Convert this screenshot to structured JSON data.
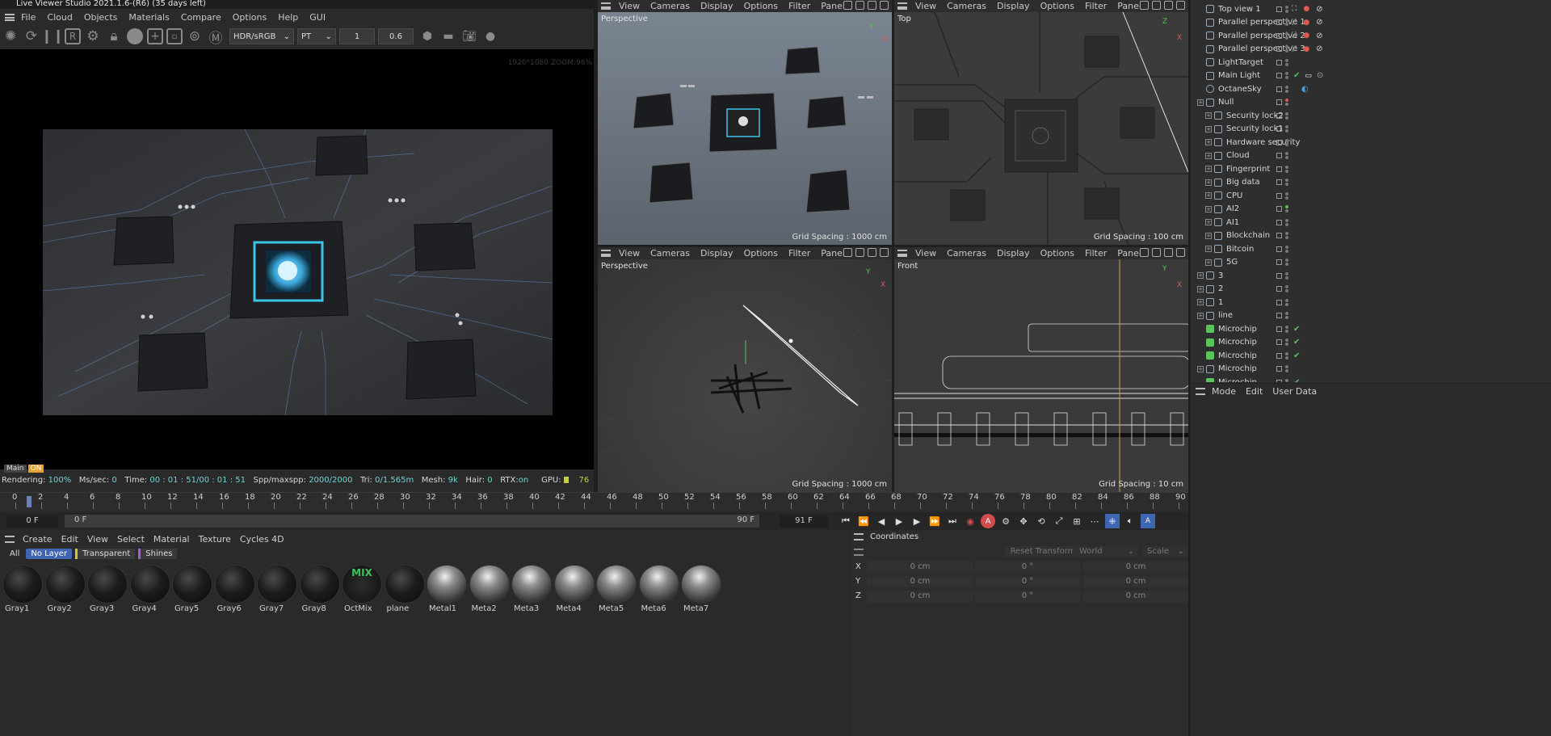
{
  "window": {
    "title": "Live Viewer Studio 2021.1.6-(R6) (35 days left)"
  },
  "lv_menu": [
    "File",
    "Cloud",
    "Objects",
    "Materials",
    "Compare",
    "Options",
    "Help",
    "GUI"
  ],
  "lv_toolbar": {
    "colorspace": "HDR/sRGB",
    "kernel": "PT",
    "value1": "1",
    "value2": "0.6"
  },
  "lv_overlay": "1920*1080 ZOOM:96%",
  "lv_tabs": {
    "main": "Main",
    "active": "ON"
  },
  "lv_status": {
    "rendering_label": "Rendering:",
    "rendering": "100%",
    "ms_label": "Ms/sec:",
    "ms": "0",
    "time_label": "Time:",
    "time": "00 : 01 : 51/00 : 01 : 51",
    "spp_label": "Spp/maxspp:",
    "spp": "2000/2000",
    "tri_label": "Tri:",
    "tri": "0/1.565m",
    "mesh_label": "Mesh:",
    "mesh": "9k",
    "hair_label": "Hair:",
    "hair": "0",
    "rtx_label": "RTX:",
    "rtx": "on",
    "gpu_label": "GPU:",
    "gpu": "76"
  },
  "viewport_menu": [
    "View",
    "Cameras",
    "Display",
    "Options",
    "Filter",
    "Panel"
  ],
  "viewports": [
    {
      "name": "Perspective",
      "grid": "Grid Spacing : 1000 cm"
    },
    {
      "name": "Top",
      "grid": "Grid Spacing : 100 cm"
    },
    {
      "name": "Perspective",
      "grid": "Grid Spacing : 1000 cm"
    },
    {
      "name": "Front",
      "grid": "Grid Spacing : 10 cm"
    }
  ],
  "axis": {
    "x": "X",
    "y": "Y"
  },
  "objects": [
    {
      "label": "Top view 1",
      "kind": "cam",
      "exp": false
    },
    {
      "label": "Parallel perspective 1",
      "kind": "cam",
      "exp": false
    },
    {
      "label": "Parallel perspective 2",
      "kind": "cam",
      "exp": false
    },
    {
      "label": "Parallel perspective 3",
      "kind": "cam",
      "exp": false
    },
    {
      "label": "LightTarget",
      "kind": "null",
      "exp": false
    },
    {
      "label": "Main Light",
      "kind": "light",
      "exp": false
    },
    {
      "label": "OctaneSky",
      "kind": "sky",
      "exp": false
    },
    {
      "label": "Null",
      "kind": "null",
      "exp": true
    },
    {
      "label": "Security lock2",
      "kind": "grp",
      "exp": true,
      "indent": 1
    },
    {
      "label": "Security lock1",
      "kind": "grp",
      "exp": true,
      "indent": 1
    },
    {
      "label": "Hardware security",
      "kind": "grp",
      "exp": true,
      "indent": 1
    },
    {
      "label": "Cloud",
      "kind": "grp",
      "exp": true,
      "indent": 1
    },
    {
      "label": "Fingerprint",
      "kind": "grp",
      "exp": true,
      "indent": 1
    },
    {
      "label": "Big data",
      "kind": "grp",
      "exp": true,
      "indent": 1
    },
    {
      "label": "CPU",
      "kind": "grp",
      "exp": true,
      "indent": 1
    },
    {
      "label": "AI2",
      "kind": "grp",
      "exp": true,
      "indent": 1
    },
    {
      "label": "AI1",
      "kind": "grp",
      "exp": true,
      "indent": 1
    },
    {
      "label": "Blockchain",
      "kind": "grp",
      "exp": true,
      "indent": 1
    },
    {
      "label": "Bitcoin",
      "kind": "grp",
      "exp": true,
      "indent": 1
    },
    {
      "label": "5G",
      "kind": "grp",
      "exp": true,
      "indent": 1
    },
    {
      "label": "3",
      "kind": "grp",
      "exp": true
    },
    {
      "label": "2",
      "kind": "grp",
      "exp": true
    },
    {
      "label": "1",
      "kind": "grp",
      "exp": true
    },
    {
      "label": "line",
      "kind": "grp",
      "exp": true
    },
    {
      "label": "Microchip",
      "kind": "mesh",
      "exp": false
    },
    {
      "label": "Microchip",
      "kind": "mesh",
      "exp": false
    },
    {
      "label": "Microchip",
      "kind": "mesh",
      "exp": false
    },
    {
      "label": "Microchip",
      "kind": "grp",
      "exp": true
    },
    {
      "label": "Microchip",
      "kind": "mesh",
      "exp": false
    }
  ],
  "attr_menu": [
    "Mode",
    "Edit",
    "User Data"
  ],
  "timeline": {
    "ticks": [
      "0",
      "2",
      "4",
      "6",
      "8",
      "10",
      "12",
      "14",
      "16",
      "18",
      "20",
      "22",
      "24",
      "26",
      "28",
      "30",
      "32",
      "34",
      "36",
      "38",
      "40",
      "42",
      "44",
      "46",
      "48",
      "50",
      "52",
      "54",
      "56",
      "58",
      "60",
      "62",
      "64",
      "66",
      "68",
      "70",
      "72",
      "74",
      "76",
      "78",
      "80",
      "82",
      "84",
      "86",
      "88",
      "90"
    ],
    "current_frame": "0 F",
    "start_frame": "0 F",
    "end_frame": "90 F",
    "max_frame": "91 F"
  },
  "mat_menu": [
    "Create",
    "Edit",
    "View",
    "Select",
    "Material",
    "Texture",
    "Cycles 4D"
  ],
  "mat_tabs": [
    "All",
    "No Layer",
    "Transparent",
    "Shines"
  ],
  "materials": [
    "Gray1",
    "Gray2",
    "Gray3",
    "Gray4",
    "Gray5",
    "Gray6",
    "Gray7",
    "Gray8",
    "OctMix",
    "plane",
    "Metal1",
    "Meta2",
    "Meta3",
    "Meta4",
    "Meta5",
    "Meta6",
    "Meta7"
  ],
  "coords": {
    "title": "Coordinates",
    "reset": "Reset Transform",
    "space": "World",
    "mode": "Scale",
    "rows": [
      {
        "axis": "X",
        "pos": "0 cm",
        "rot": "0 °",
        "size": "0 cm"
      },
      {
        "axis": "Y",
        "pos": "0 cm",
        "rot": "0 °",
        "size": "0 cm"
      },
      {
        "axis": "Z",
        "pos": "0 cm",
        "rot": "0 °",
        "size": "0 cm"
      }
    ]
  },
  "colors": {
    "accent": "#5fa8d3",
    "record": "#d44b4b",
    "check": "#58c45a",
    "highlight": "#3f66b3"
  }
}
